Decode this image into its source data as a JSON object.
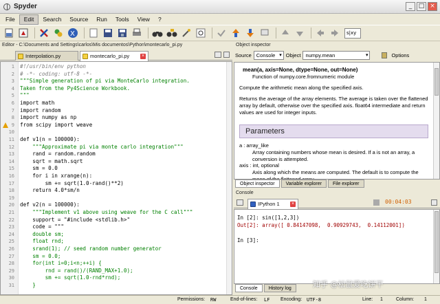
{
  "window": {
    "title": "Spyder",
    "buttons": [
      "_",
      "□",
      "×"
    ]
  },
  "menu": [
    "File",
    "Edit",
    "Search",
    "Source",
    "Run",
    "Tools",
    "View",
    "?"
  ],
  "menu_active": "Edit",
  "toolbar": {
    "icons": [
      "new-file-icon",
      "run-icon",
      "stop-icon",
      "tools-icon",
      "python-icon",
      "open-icon",
      "save-icon",
      "save-all-icon",
      "print-icon",
      "binoculars-icon",
      "binoculars-replace-icon",
      "wand-icon",
      "find-icon",
      "check-icon",
      "indent-icon",
      "unindent-icon",
      "comment-icon",
      "move-up-icon",
      "move-down-icon",
      "back-icon",
      "forward-icon"
    ],
    "combo_value": "s|xy"
  },
  "editor": {
    "header": "Editor - C:\\Documents and Settings\\carlos\\Mis documentos\\Python\\montecarlo_pi.py",
    "tabs": [
      "Interpolation.py",
      "montecarlo_pi.py"
    ],
    "active_tab": "montecarlo_pi.py",
    "lines": [
      {
        "n": "1",
        "text": "#!/usr/bin/env python",
        "cls": "c-cm"
      },
      {
        "n": "2",
        "text": "# -*- coding: utf-8 -*-",
        "cls": "c-cm"
      },
      {
        "n": "3",
        "text": "\"\"\"Simple generation of pi via MonteCarlo integration.",
        "cls": "c-str"
      },
      {
        "n": "4",
        "text": "Taken from the Py4Science Workbook.",
        "cls": "c-str"
      },
      {
        "n": "5",
        "text": "\"\"\"",
        "cls": "c-str"
      },
      {
        "n": "6",
        "text": "import math",
        "cls": ""
      },
      {
        "n": "7",
        "text": "import random",
        "cls": ""
      },
      {
        "n": "8",
        "text": "import numpy as np",
        "cls": ""
      },
      {
        "n": "9",
        "text": "from scipy import weave",
        "cls": ""
      },
      {
        "n": "10",
        "text": "",
        "cls": ""
      },
      {
        "n": "11",
        "text": "def v1(n = 100000):",
        "cls": ""
      },
      {
        "n": "12",
        "text": "    \"\"\"Approximate pi via monte carlo integration\"\"\"",
        "cls": "c-str"
      },
      {
        "n": "13",
        "text": "    rand = random.random",
        "cls": ""
      },
      {
        "n": "14",
        "text": "    sqrt = math.sqrt",
        "cls": ""
      },
      {
        "n": "15",
        "text": "    sm = 0.0",
        "cls": ""
      },
      {
        "n": "16",
        "text": "    for i in xrange(n):",
        "cls": ""
      },
      {
        "n": "17",
        "text": "        sm += sqrt(1.0-rand()**2)",
        "cls": ""
      },
      {
        "n": "18",
        "text": "    return 4.0*sm/n",
        "cls": ""
      },
      {
        "n": "19",
        "text": "",
        "cls": ""
      },
      {
        "n": "20",
        "text": "def v2(n = 100000):",
        "cls": ""
      },
      {
        "n": "21",
        "text": "    \"\"\"Implement v1 above using weave for the C call\"\"\"",
        "cls": "c-str"
      },
      {
        "n": "22",
        "text": "    support = \"#include <stdlib.h>\"",
        "cls": ""
      },
      {
        "n": "23",
        "text": "    code = \"\"\"",
        "cls": ""
      },
      {
        "n": "24",
        "text": "    double sm;",
        "cls": "c-str"
      },
      {
        "n": "25",
        "text": "    float rnd;",
        "cls": "c-str"
      },
      {
        "n": "26",
        "text": "    srand(1); // seed random number generator",
        "cls": "c-str"
      },
      {
        "n": "27",
        "text": "    sm = 0.0;",
        "cls": "c-str"
      },
      {
        "n": "28",
        "text": "    for(int i=0;i<n;++i) {",
        "cls": "c-str"
      },
      {
        "n": "29",
        "text": "        rnd = rand()/(RAND_MAX+1.0);",
        "cls": "c-str"
      },
      {
        "n": "30",
        "text": "        sm += sqrt(1.0-rnd*rnd);",
        "cls": "c-str"
      },
      {
        "n": "31",
        "text": "    }",
        "cls": "c-str"
      }
    ]
  },
  "inspector": {
    "header": "Object inspector",
    "source_label": "Source",
    "source_value": "Console",
    "object_label": "Object",
    "object_value": "numpy.mean",
    "options_label": "Options",
    "signature": "mean(a, axis=None, dtype=None, out=None)",
    "function_of": "Function of numpy.core.fromnumeric module",
    "summary": "Compute the arithmetic mean along the specified axis.",
    "description": "Returns the average of the array elements. The average is taken over the flattened array by default, otherwise over the specified axis. float64 intermediate and return values are used for integer inputs.",
    "params_title": "Parameters",
    "param1_name": "a : array_like",
    "param1_desc": "Array containing numbers whose mean is desired. If a is not an array, a conversion is attempted.",
    "param2_name": "axis : int, optional",
    "param2_desc": "Axis along which the means are computed. The default is to compute the mean of the flattened array.",
    "tabs": [
      "Object inspector",
      "Variable explorer",
      "File explorer"
    ]
  },
  "console": {
    "header": "Console",
    "tab": "IPython 1",
    "timer": "00:04:03",
    "lines": [
      "In [2]: sin([1,2,3])",
      "Out[2]: array([ 0.84147098,  0.90929743,  0.14112001])",
      "",
      "In [3]:"
    ],
    "bottom_tabs": [
      "Console",
      "History log"
    ]
  },
  "status": {
    "permissions_label": "Permissions:",
    "permissions": "RW",
    "eol_label": "End-of-lines:",
    "eol": "LF",
    "encoding_label": "Encoding:",
    "encoding": "UTF-8",
    "line_label": "Line:",
    "line": "1",
    "column_label": "Column:",
    "column": "1"
  },
  "watermark": "知乎 @松鼠爱吃饼干"
}
